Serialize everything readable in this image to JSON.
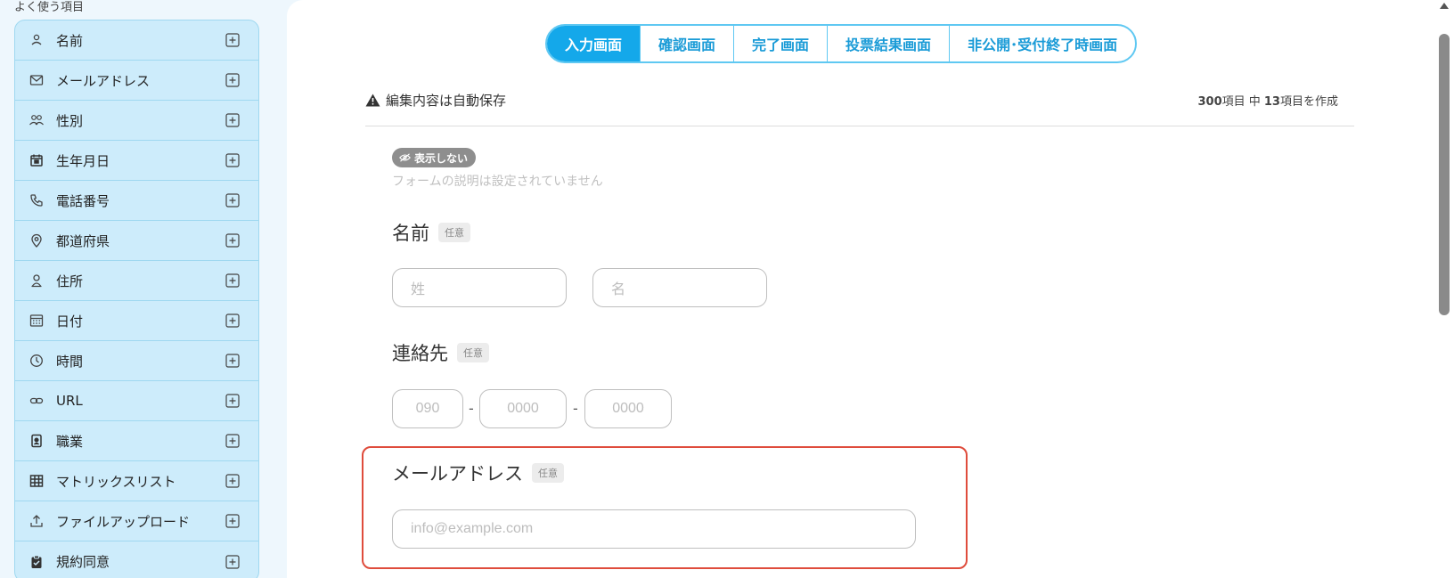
{
  "sidebar": {
    "title": "よく使う項目",
    "items": [
      {
        "label": "名前",
        "icon": "person-icon"
      },
      {
        "label": "メールアドレス",
        "icon": "envelope-icon"
      },
      {
        "label": "性別",
        "icon": "people-icon"
      },
      {
        "label": "生年月日",
        "icon": "calendar-icon"
      },
      {
        "label": "電話番号",
        "icon": "phone-icon"
      },
      {
        "label": "都道府県",
        "icon": "location-pin-icon"
      },
      {
        "label": "住所",
        "icon": "address-person-icon"
      },
      {
        "label": "日付",
        "icon": "calendar-grid-icon"
      },
      {
        "label": "時間",
        "icon": "clock-icon"
      },
      {
        "label": "URL",
        "icon": "link-icon"
      },
      {
        "label": "職業",
        "icon": "id-badge-icon"
      },
      {
        "label": "マトリックスリスト",
        "icon": "table-icon"
      },
      {
        "label": "ファイルアップロード",
        "icon": "upload-icon"
      },
      {
        "label": "規約同意",
        "icon": "clipboard-check-icon"
      }
    ]
  },
  "tabs": [
    {
      "label": "入力画面",
      "active": true
    },
    {
      "label": "確認画面",
      "active": false
    },
    {
      "label": "完了画面",
      "active": false
    },
    {
      "label": "投票結果画面",
      "active": false
    },
    {
      "label": "非公開･受付終了時画面",
      "active": false
    }
  ],
  "header": {
    "autosave": "編集内容は自動保存",
    "count_total": "300",
    "count_mid": "項目 中 ",
    "count_made": "13",
    "count_suffix": "項目を作成"
  },
  "form": {
    "hidden_badge": "表示しない",
    "description": "フォームの説明は設定されていません",
    "optional_label": "任意",
    "name": {
      "title": "名前",
      "last_placeholder": "姓",
      "first_placeholder": "名"
    },
    "contact": {
      "title": "連絡先",
      "part1": "090",
      "part2": "0000",
      "part3": "0000",
      "separator": "-"
    },
    "email": {
      "title": "メールアドレス",
      "placeholder": "info@example.com"
    }
  },
  "colors": {
    "accent": "#14a8ea",
    "sidebar_bg": "#cdecfb",
    "highlight": "#df4c3c"
  }
}
